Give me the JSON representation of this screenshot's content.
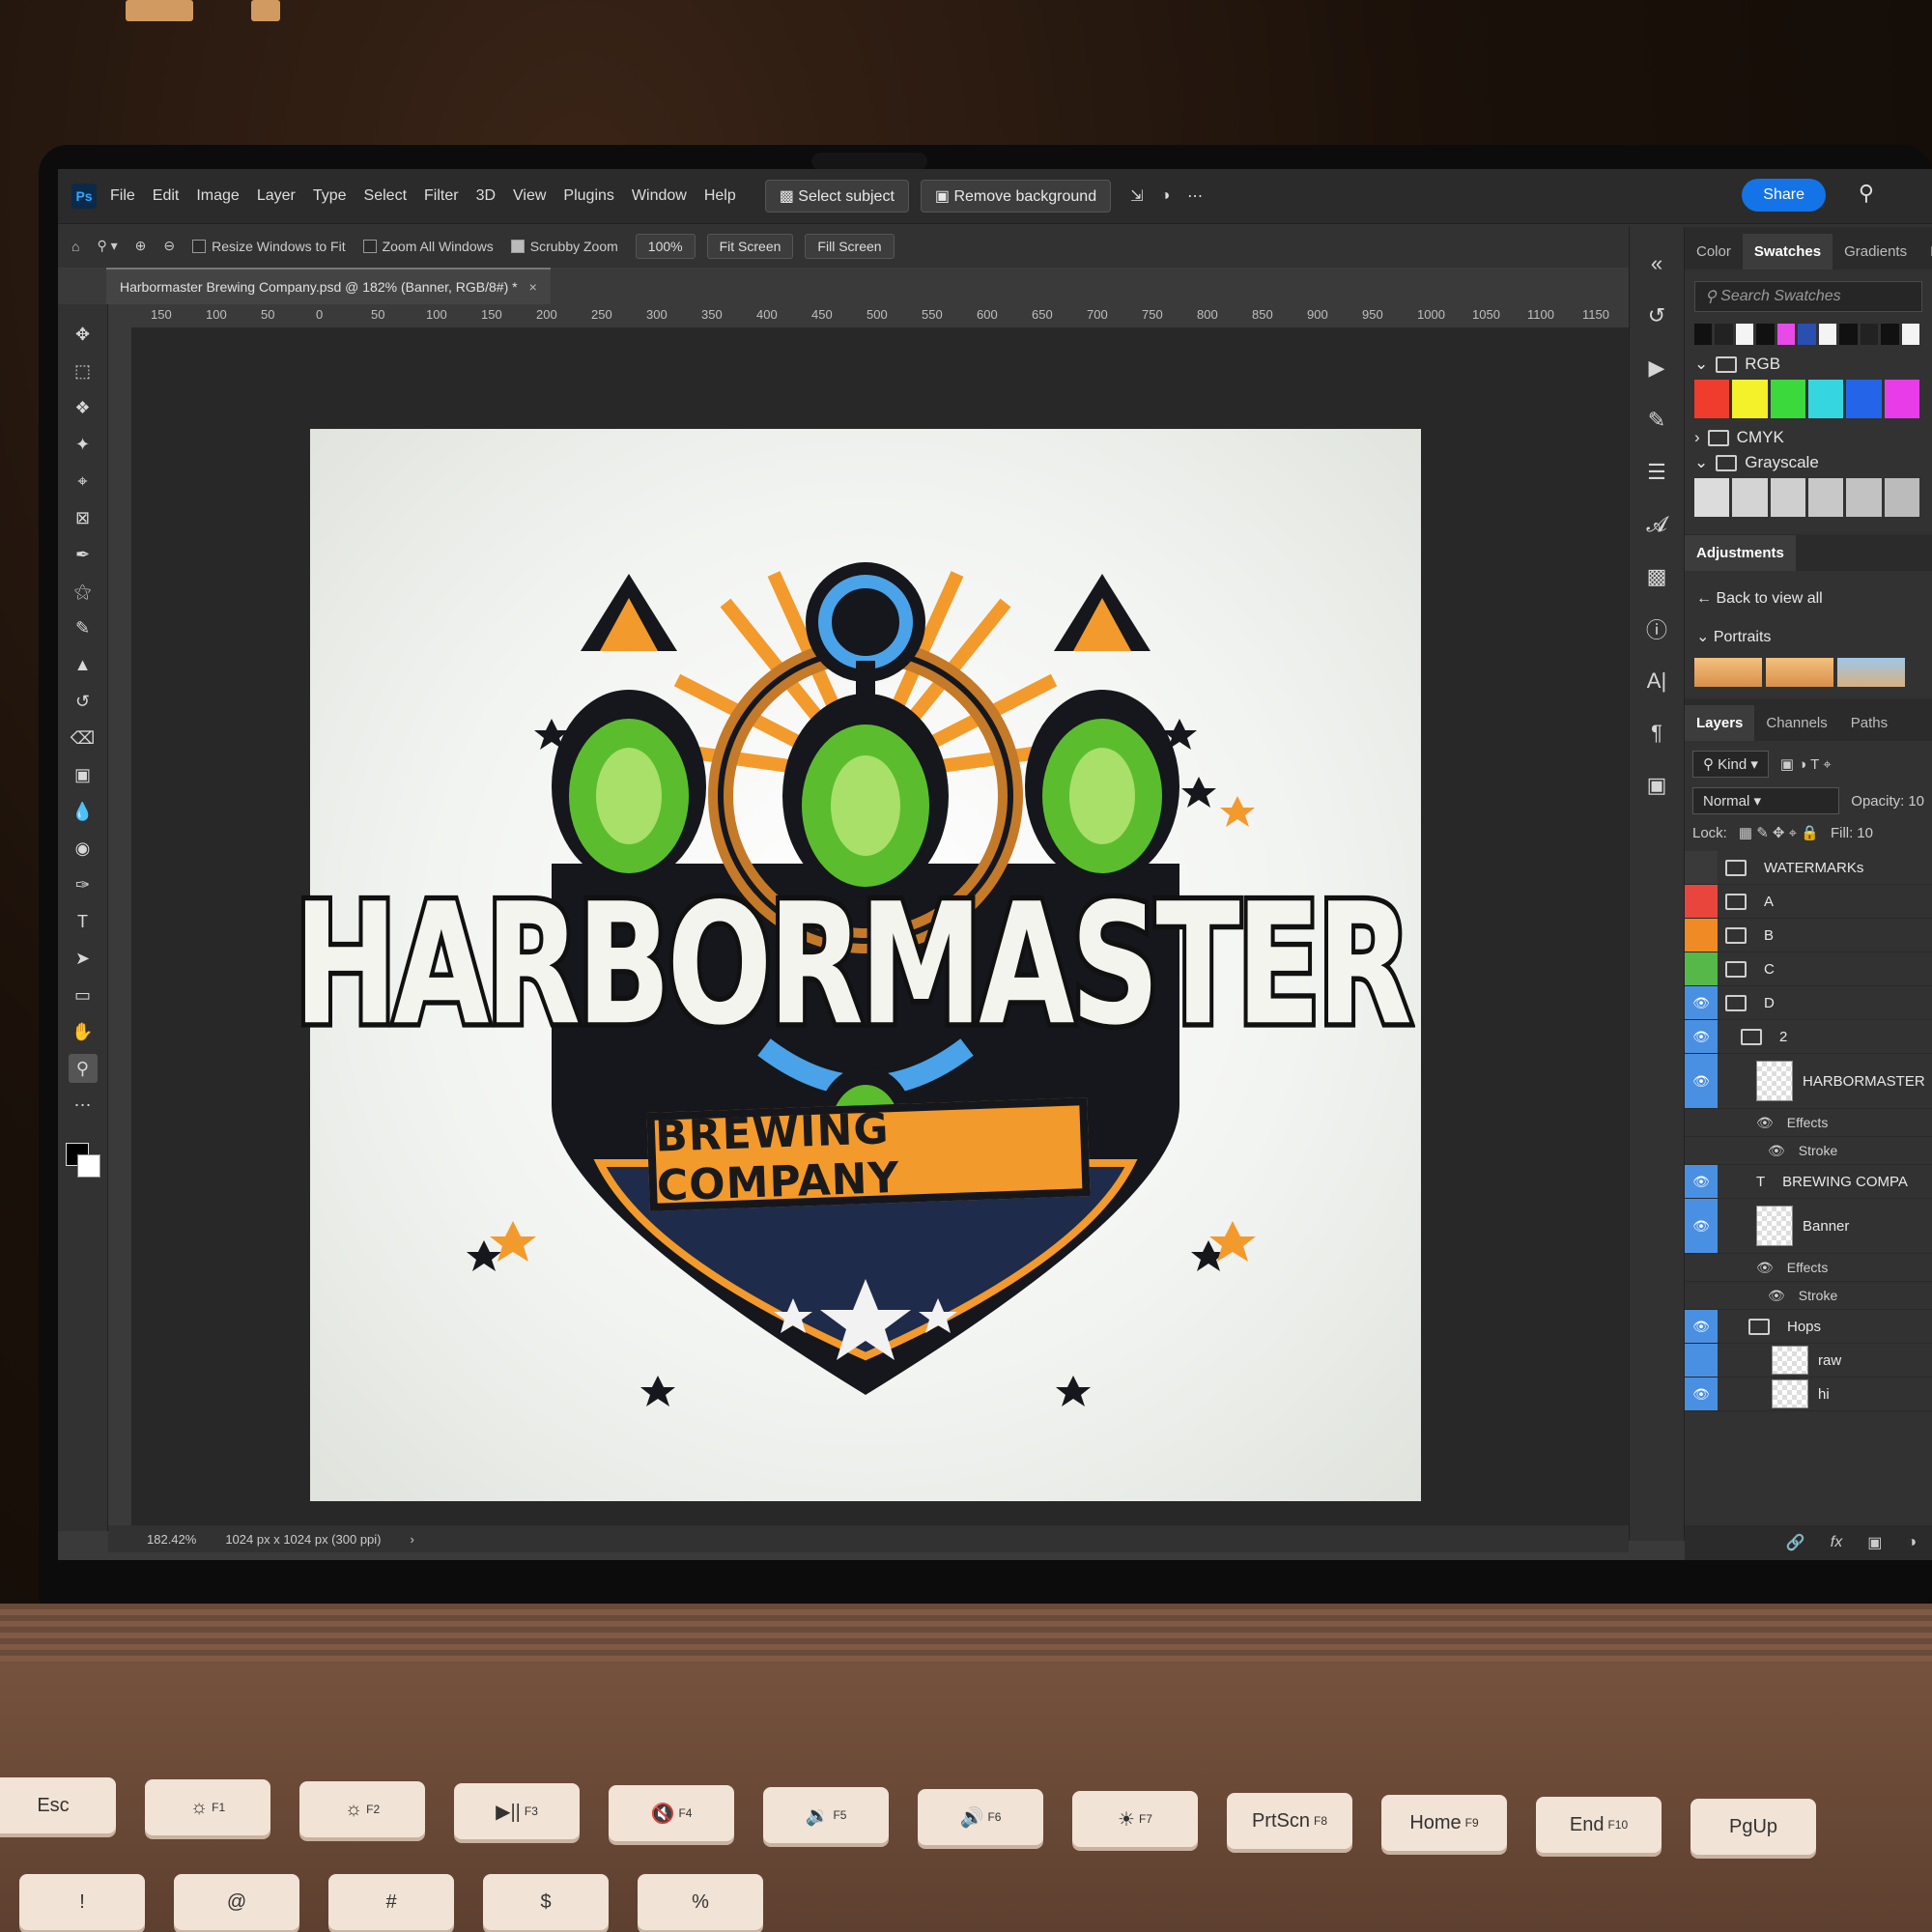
{
  "app": {
    "menu": [
      "File",
      "Edit",
      "Image",
      "Layer",
      "Type",
      "Select",
      "Filter",
      "3D",
      "View",
      "Plugins",
      "Window",
      "Help"
    ],
    "context_buttons": [
      "Select subject",
      "Remove background"
    ],
    "share_label": "Share"
  },
  "options_bar": {
    "resize_windows": "Resize Windows to Fit",
    "zoom_all": "Zoom All Windows",
    "scrubby_zoom": "Scrubby Zoom",
    "zoom_value": "100%",
    "fit_screen": "Fit Screen",
    "fill_screen": "Fill Screen"
  },
  "document": {
    "tab_title": "Harbormaster Brewing Company.psd @ 182% (Banner, RGB/8#) *",
    "close": "×",
    "status_zoom": "182.42%",
    "status_info": "1024 px x 1024 px (300 ppi)",
    "status_arrow": "›"
  },
  "ruler": {
    "ticks": [
      "150",
      "100",
      "50",
      "0",
      "50",
      "100",
      "150",
      "200",
      "250",
      "300",
      "350",
      "400",
      "450",
      "500",
      "550",
      "600",
      "650",
      "700",
      "750",
      "800",
      "850",
      "900",
      "950",
      "1000",
      "1050",
      "1100",
      "1150"
    ]
  },
  "artwork": {
    "title": "HARBORMASTER",
    "subtitle": "BREWING COMPANY"
  },
  "panels": {
    "tabs": [
      "Color",
      "Swatches",
      "Gradients",
      "Patterns"
    ],
    "swatch_search_placeholder": "Search Swatches",
    "groups": {
      "rgb": "RGB",
      "cmyk": "CMYK",
      "grayscale": "Grayscale"
    },
    "adjustments_tab": "Adjustments",
    "back_to_all": "Back to view all",
    "portraits": "Portraits",
    "layer_tabs": [
      "Layers",
      "Channels",
      "Paths"
    ],
    "kind": "Kind",
    "blend_mode": "Normal",
    "opacity_label": "Opacity:",
    "lock_label": "Lock:",
    "fill_label": "Fill:",
    "opacity_value": "10",
    "fill_value": "10"
  },
  "layers": [
    {
      "name": "WATERMARKs",
      "type": "group",
      "color": "none"
    },
    {
      "name": "A",
      "type": "group",
      "color": "#e8463c"
    },
    {
      "name": "B",
      "type": "group",
      "color": "#f08a24"
    },
    {
      "name": "C",
      "type": "group",
      "color": "#55b848"
    },
    {
      "name": "D",
      "type": "group",
      "color": "#4a90e2"
    },
    {
      "name": "2",
      "type": "group"
    },
    {
      "name": "HARBORMASTER",
      "type": "smart"
    },
    {
      "name": "Effects",
      "type": "effect"
    },
    {
      "name": "Stroke",
      "type": "effect"
    },
    {
      "name": "BREWING COMPA",
      "type": "text"
    },
    {
      "name": "Banner",
      "type": "smart"
    },
    {
      "name": "Effects",
      "type": "effect"
    },
    {
      "name": "Stroke",
      "type": "effect"
    },
    {
      "name": "Hops",
      "type": "group"
    },
    {
      "name": "raw",
      "type": "layer"
    },
    {
      "name": "hi",
      "type": "layer"
    }
  ],
  "swatches": {
    "top": [
      "#111111",
      "#222222",
      "#f4f4f4",
      "#111111",
      "#e84ae8",
      "#2a4fb0",
      "#f4f4f4",
      "#111111",
      "#222222",
      "#111111",
      "#f4f4f4"
    ],
    "rgb": [
      "#f03c2c",
      "#f4f02a",
      "#3cd93c",
      "#36d6e0",
      "#2464e8",
      "#e83ce8"
    ],
    "gray": [
      "#dcdcdc",
      "#d4d4d4",
      "#cfcfcf",
      "#c8c8c8",
      "#c2c2c2",
      "#bbbbbb"
    ]
  },
  "keyboard": [
    {
      "label": "Esc",
      "sub": ""
    },
    {
      "label": "☼",
      "sub": "F1"
    },
    {
      "label": "☼",
      "sub": "F2"
    },
    {
      "label": "▶||",
      "sub": "F3"
    },
    {
      "label": "🔇",
      "sub": "F4"
    },
    {
      "label": "🔉",
      "sub": "F5"
    },
    {
      "label": "🔊",
      "sub": "F6"
    },
    {
      "label": "☀",
      "sub": "F7"
    },
    {
      "label": "PrtScn",
      "sub": "F8"
    },
    {
      "label": "Home",
      "sub": "F9"
    },
    {
      "label": "End",
      "sub": "F10"
    },
    {
      "label": "PgUp",
      "sub": ""
    }
  ],
  "keyboard_row2": [
    "!",
    "@",
    "#",
    "$",
    "%"
  ]
}
